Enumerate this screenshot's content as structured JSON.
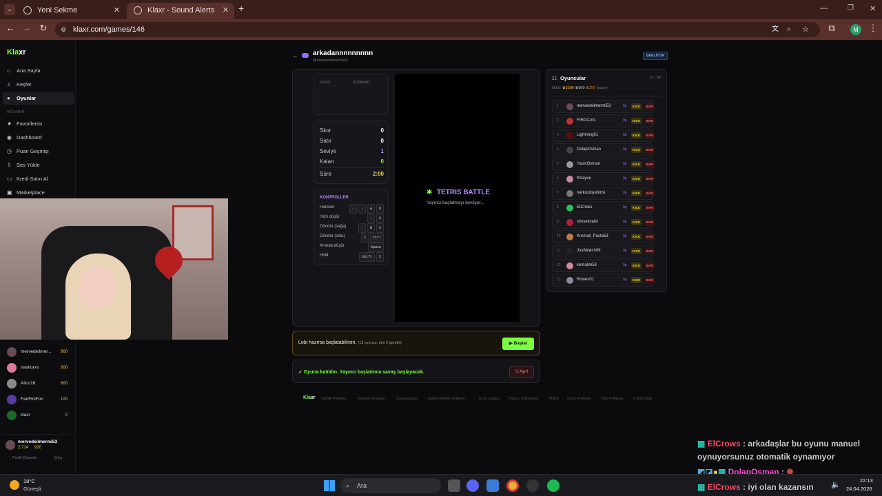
{
  "browser": {
    "tabs": [
      {
        "label": "Yeni Sekme",
        "active": false
      },
      {
        "label": "Klaxr - Sound Alerts",
        "active": true
      }
    ],
    "url": "klaxr.com/games/146",
    "profile_initial": "M"
  },
  "sidebar": {
    "logo_a": "Kla",
    "logo_b": "xr",
    "items": [
      {
        "label": "Ana Sayfa",
        "icon": "home-icon"
      },
      {
        "label": "Keşfet",
        "icon": "music-note-icon"
      },
      {
        "label": "Oyunlar",
        "icon": "gamepad-icon"
      }
    ],
    "section": "HESABIM",
    "account_items": [
      {
        "label": "Favorilerim",
        "icon": "star-icon"
      },
      {
        "label": "Dashboard",
        "icon": "dashboard-icon"
      },
      {
        "label": "Puan Geçmişi",
        "icon": "history-icon"
      },
      {
        "label": "Ses Yükle",
        "icon": "upload-icon"
      },
      {
        "label": "Kredi Satın Al",
        "icon": "card-icon"
      },
      {
        "label": "Marketplace",
        "icon": "store-icon"
      }
    ],
    "leaderboard": [
      {
        "name": "mervedeilmer...",
        "points": "900",
        "color": "#6b4a52"
      },
      {
        "name": "nashorxs",
        "points": "800",
        "color": "#e07a9a"
      },
      {
        "name": "Alico16",
        "points": "600",
        "color": "#8a8a8a"
      },
      {
        "name": "FanFiniFon",
        "points": "100",
        "color": "#5a3aa0"
      },
      {
        "name": "klaxr",
        "points": "0",
        "color": "#1d6b2a"
      }
    ],
    "user": {
      "name": "mervedeilmermi53",
      "credits": "2.714",
      "points": "920"
    },
    "profile_edit": "Profili Düzenle",
    "logout": "Çıkış"
  },
  "game": {
    "title": "arkadannnnnnnnn",
    "handle": "@mervedeilmermi53",
    "status_badge": "BEKLİYOR",
    "hold_label": "HOLD",
    "next_label": "SONRAKİ",
    "stats": [
      {
        "label": "Skor",
        "value": "0",
        "color": "#ffffff"
      },
      {
        "label": "Satır",
        "value": "0",
        "color": "#ffffff"
      },
      {
        "label": "Seviye",
        "value": "1",
        "color": "#b98cff"
      },
      {
        "label": "Kalan",
        "value": "0",
        "color": "#7cff3c"
      },
      {
        "label": "Süre",
        "value": "2:00",
        "color": "#f5d442"
      }
    ],
    "controls_title": "KONTROLLER",
    "controls": [
      {
        "label": "Hareket",
        "keys": [
          "←",
          "→",
          "A",
          "D"
        ]
      },
      {
        "label": "Hızlı düşür",
        "keys": [
          "↓",
          "S"
        ]
      },
      {
        "label": "Döndür (sağa)",
        "keys": [
          "↑",
          "W",
          "X"
        ]
      },
      {
        "label": "Döndür (sola)",
        "keys": [
          "Z",
          "Ctrl"
        ]
      },
      {
        "label": "Anında düşür",
        "keys": [
          "Space"
        ]
      },
      {
        "label": "Hold",
        "keys": [
          "Shift",
          "C"
        ]
      }
    ],
    "board_title": "TETRIS BATTLE",
    "board_subtitle": "Yayıncı başlatmayı bekliyor...",
    "lobby_text": "Lobi hazırsa başlatabilirsin.",
    "lobby_sub": "(13 oyuncu, min 2 gerekli)",
    "start_button": "Başlat",
    "joined_text": "✓ Oyuna katıldın. Yayıncı başlatınca savaş başlayacak.",
    "leave_button": "Ayrıl"
  },
  "players": {
    "title": "Oyuncular",
    "count": "13 / 99",
    "prize_label": "Ödül:",
    "prizes": [
      "1000",
      "500",
      "250"
    ],
    "prize_unit": "(puan)",
    "rows": [
      {
        "rank": "1",
        "name": "mervedeilmermi53",
        "pts": "0p",
        "color": "#6b4a52"
      },
      {
        "rank": "2",
        "name": "FIROCAN",
        "pts": "0p",
        "color": "#c23030"
      },
      {
        "rank": "3",
        "name": "Lightning61",
        "pts": "0p",
        "color": "#5a1010"
      },
      {
        "rank": "4",
        "name": "DolapOsman",
        "pts": "0p",
        "color": "#444"
      },
      {
        "rank": "5",
        "name": "YasinOsman",
        "pts": "0p",
        "color": "#999"
      },
      {
        "rank": "6",
        "name": "KKayuu",
        "pts": "0p",
        "color": "#c88aa0"
      },
      {
        "rank": "7",
        "name": "narkozdiyebirisi",
        "pts": "0p",
        "color": "#777"
      },
      {
        "rank": "8",
        "name": "ElCrows",
        "pts": "0p",
        "color": "#2ebd5a"
      },
      {
        "rank": "9",
        "name": "simsekvalvi",
        "pts": "0p",
        "color": "#b02040"
      },
      {
        "rank": "10",
        "name": "Kremali_Pasta53",
        "pts": "0p",
        "color": "#c07a40"
      },
      {
        "rank": "11",
        "name": "JustWatch09",
        "pts": "0p",
        "color": "#222"
      },
      {
        "rank": "12",
        "name": "kemalim53",
        "pts": "0p",
        "color": "#d08a9a"
      },
      {
        "rank": "13",
        "name": "Rowes01",
        "pts": "0p",
        "color": "#8a8aa0"
      }
    ],
    "kick": "KICK",
    "ban": "BAN"
  },
  "footer": {
    "logo_a": "Kla",
    "logo_b": "xr",
    "links": [
      "Gizlilik Politikası",
      "Kullanım Koşulları",
      "Satış Koşulları",
      "Kabul Edilebilir Kullanım",
      "İçerik Lisansı",
      "Yayıncı Sözleşmesi",
      "DMCA",
      "Çerez Politikası",
      "İade Politikası"
    ],
    "copyright": "© 2026 Klaxr"
  },
  "chat": [
    {
      "user": "ElCrows",
      "text": ": arkadaşlar bu oyunu manuel",
      "user_color": "#ff4d6d"
    },
    {
      "user": "",
      "text": "oynuyorsunuz otomatik oynamıyor",
      "user_color": "#ff4d6d"
    },
    {
      "user": "DolapOsman",
      "text": ":",
      "user_color": "#ff4dd2"
    },
    {
      "user": "ElCrows",
      "text": ": iyi olan kazansın",
      "user_color": "#ff4d6d"
    }
  ],
  "taskbar": {
    "weather_temp": "18°C",
    "weather_desc": "Güneşli",
    "search": "Ara",
    "time": "22:13",
    "date": "24.04.2026"
  }
}
